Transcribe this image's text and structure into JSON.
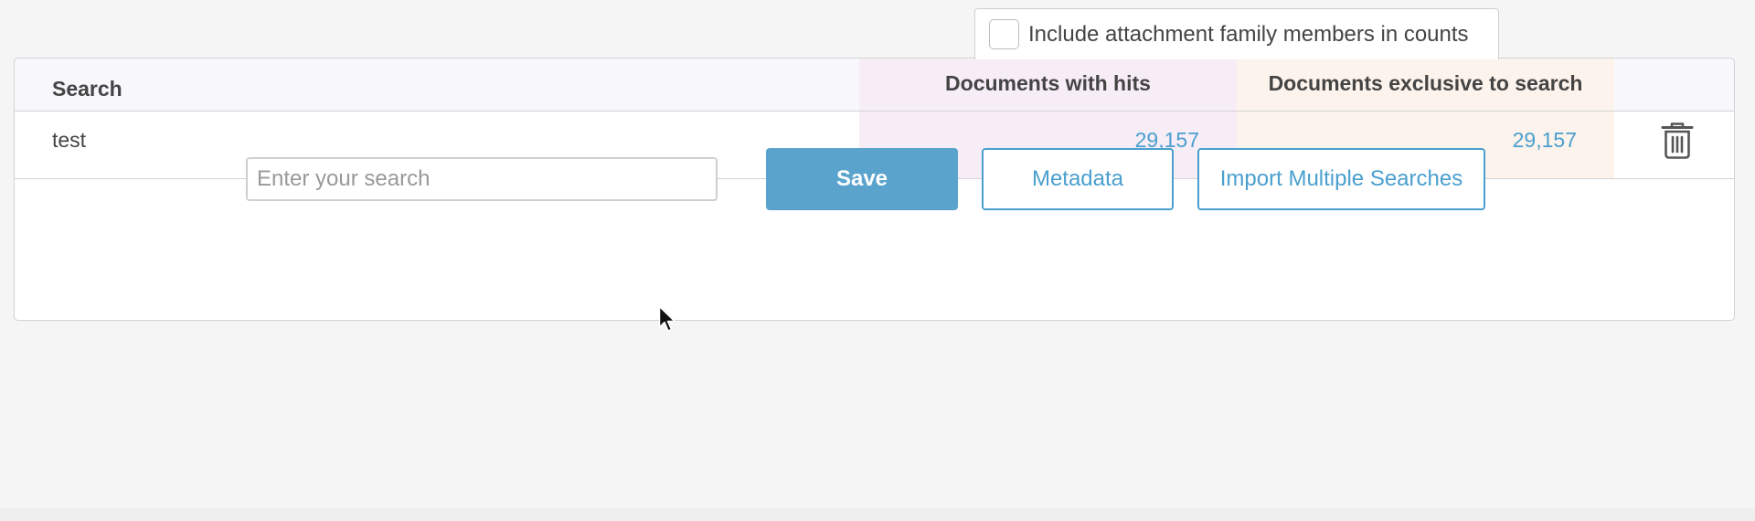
{
  "options": {
    "include_family_label": "Include attachment family members in counts",
    "include_family_checked": false
  },
  "table": {
    "headers": {
      "search": "Search",
      "hits": "Documents with hits",
      "exclusive": "Documents exclusive to search"
    },
    "rows": [
      {
        "term": "test",
        "hits": "29,157",
        "exclusive": "29,157"
      }
    ]
  },
  "controls": {
    "search_placeholder": "Enter your search",
    "save_label": "Save",
    "metadata_label": "Metadata",
    "import_label": "Import Multiple Searches"
  },
  "icons": {
    "delete": "trash-icon",
    "checkbox": "checkbox-icon",
    "cursor": "cursor-icon"
  },
  "colors": {
    "accent": "#4a9fcf",
    "save_bg": "#5aa3cd",
    "hits_bg": "#f7edf6",
    "exclusive_bg": "#fcf3ec"
  }
}
